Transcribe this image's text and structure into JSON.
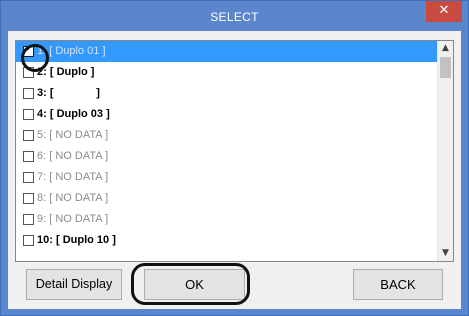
{
  "window": {
    "title": "SELECT",
    "close_glyph": "✕"
  },
  "list": {
    "items": [
      {
        "number": "1:",
        "name": "[ Duplo 01 ]",
        "checked": true,
        "selected": true,
        "nodata": false
      },
      {
        "number": "2:",
        "name": "[ Duplo ]",
        "checked": false,
        "selected": false,
        "nodata": false
      },
      {
        "number": "3:",
        "name": "[              ]",
        "checked": false,
        "selected": false,
        "nodata": false
      },
      {
        "number": "4:",
        "name": "[ Duplo 03 ]",
        "checked": false,
        "selected": false,
        "nodata": false
      },
      {
        "number": "5:",
        "name": "[ NO DATA ]",
        "checked": false,
        "selected": false,
        "nodata": true
      },
      {
        "number": "6:",
        "name": "[ NO DATA ]",
        "checked": false,
        "selected": false,
        "nodata": true
      },
      {
        "number": "7:",
        "name": "[ NO DATA ]",
        "checked": false,
        "selected": false,
        "nodata": true
      },
      {
        "number": "8:",
        "name": "[ NO DATA ]",
        "checked": false,
        "selected": false,
        "nodata": true
      },
      {
        "number": "9:",
        "name": "[ NO DATA ]",
        "checked": false,
        "selected": false,
        "nodata": true
      },
      {
        "number": "10:",
        "name": "[ Duplo 10 ]",
        "checked": false,
        "selected": false,
        "nodata": false
      }
    ],
    "check_glyph": "✔",
    "scroll_up_glyph": "▲",
    "scroll_down_glyph": "▼"
  },
  "buttons": {
    "detail_display": "Detail Display",
    "ok": "OK",
    "back": "BACK"
  },
  "icons": {
    "close": "close-icon",
    "check": "checkmark-icon",
    "scroll_up": "chevron-up-icon",
    "scroll_down": "chevron-down-icon"
  },
  "colors": {
    "titlebar": "#5b86cb",
    "selection": "#3399ff",
    "close_button": "#c94a3e",
    "nodata_text": "#8c8c8c"
  }
}
